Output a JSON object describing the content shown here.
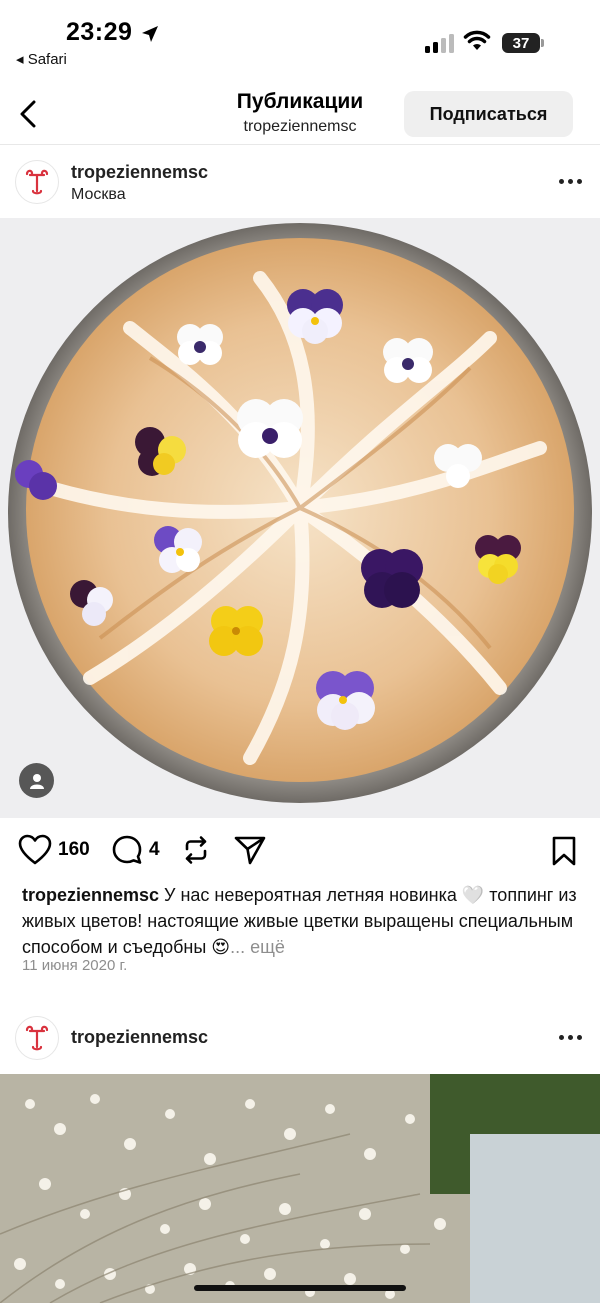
{
  "status_bar": {
    "time": "23:29",
    "back_app": "◂ Safari",
    "battery": "37"
  },
  "header": {
    "title": "Публикации",
    "subtitle": "tropeziennemsc",
    "follow_label": "Подписаться"
  },
  "post": {
    "username": "tropeziennemsc",
    "location": "Москва",
    "likes": "160",
    "comments": "4",
    "caption_user": "tropeziennemsc",
    "caption_text": " У нас невероятная летняя новинка 🤍 топпинг из живых цветов! настоящие живые цветки выращены специальным способом и съедобны 😍",
    "caption_more": "... ещё",
    "date": "11 июня 2020 г."
  },
  "post2": {
    "username": "tropeziennemsc"
  },
  "colors": {
    "brand_red": "#d9323e",
    "button_bg": "#efefef",
    "muted": "#8e8e8e"
  }
}
